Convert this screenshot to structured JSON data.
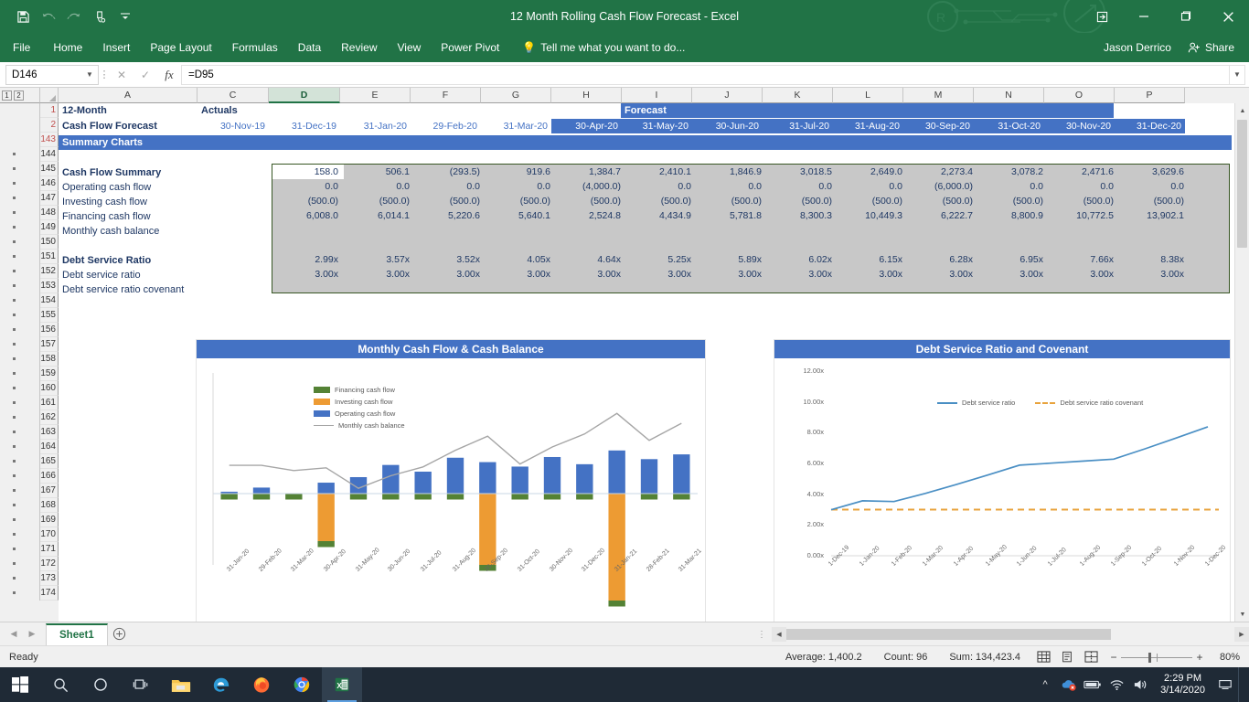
{
  "window": {
    "title": "12 Month Rolling Cash Flow Forecast - Excel",
    "user": "Jason Derrico",
    "share_label": "Share",
    "restore_icon": "restore-up-icon",
    "minimize_icon": "minimize-icon",
    "maximize_icon": "maximize-icon",
    "close_icon": "close-icon"
  },
  "qat": {
    "save": "save-icon",
    "undo": "undo-icon",
    "redo": "redo-icon",
    "touch": "touch-mode-icon",
    "more": "customize-qat-icon"
  },
  "ribbon": {
    "tabs": [
      "File",
      "Home",
      "Insert",
      "Page Layout",
      "Formulas",
      "Data",
      "Review",
      "View",
      "Power Pivot"
    ],
    "tellme": "Tell me what you want to do..."
  },
  "formula_bar": {
    "namebox": "D146",
    "formula": "=D95",
    "cancel_icon": "cancel-icon",
    "enter_icon": "enter-icon",
    "fx_icon": "insert-function-icon"
  },
  "grid": {
    "outline_levels": [
      "1",
      "2"
    ],
    "columns": [
      "A",
      "C",
      "D",
      "E",
      "F",
      "G",
      "H",
      "I",
      "J",
      "K",
      "L",
      "M",
      "N",
      "O",
      "P"
    ],
    "active_column": "D",
    "rows": [
      "1",
      "2",
      "143",
      "144",
      "145",
      "146",
      "147",
      "148",
      "149",
      "150",
      "151",
      "152",
      "153",
      "154",
      "155",
      "156",
      "157",
      "158",
      "159",
      "160",
      "161",
      "162",
      "163",
      "164",
      "165",
      "166",
      "167",
      "168",
      "169",
      "170",
      "171",
      "172",
      "173",
      "174"
    ],
    "title_row1_a": "12-Month",
    "title_row2_a": "Cash Flow Forecast",
    "actuals_label": "Actuals",
    "forecast_label": "Forecast",
    "summary_charts_label": "Summary Charts",
    "dates": [
      "30-Nov-19",
      "31-Dec-19",
      "31-Jan-20",
      "29-Feb-20",
      "31-Mar-20",
      "30-Apr-20",
      "31-May-20",
      "30-Jun-20",
      "31-Jul-20",
      "31-Aug-20",
      "30-Sep-20",
      "31-Oct-20",
      "30-Nov-20",
      "31-Dec-20"
    ],
    "row_labels": {
      "r145": "Cash Flow Summary",
      "r146": "Operating cash flow",
      "r147": "Investing cash flow",
      "r148": "Financing cash flow",
      "r149": "Monthly cash balance",
      "r151": "Debt Service Ratio",
      "r152": "Debt service ratio",
      "r153": "Debt service ratio covenant"
    },
    "table": {
      "operating_cash_flow": [
        "158.0",
        "506.1",
        "(293.5)",
        "919.6",
        "1,384.7",
        "2,410.1",
        "1,846.9",
        "3,018.5",
        "2,649.0",
        "2,273.4",
        "3,078.2",
        "2,471.6",
        "3,629.6"
      ],
      "investing_cash_flow": [
        "0.0",
        "0.0",
        "0.0",
        "0.0",
        "(4,000.0)",
        "0.0",
        "0.0",
        "0.0",
        "0.0",
        "(6,000.0)",
        "0.0",
        "0.0",
        "0.0"
      ],
      "financing_cash_flow": [
        "(500.0)",
        "(500.0)",
        "(500.0)",
        "(500.0)",
        "(500.0)",
        "(500.0)",
        "(500.0)",
        "(500.0)",
        "(500.0)",
        "(500.0)",
        "(500.0)",
        "(500.0)",
        "(500.0)"
      ],
      "monthly_cash_balance": [
        "6,008.0",
        "6,014.1",
        "5,220.6",
        "5,640.1",
        "2,524.8",
        "4,434.9",
        "5,781.8",
        "8,300.3",
        "10,449.3",
        "6,222.7",
        "8,800.9",
        "10,772.5",
        "13,902.1"
      ],
      "debt_service_ratio": [
        "2.99x",
        "3.57x",
        "3.52x",
        "4.05x",
        "4.64x",
        "5.25x",
        "5.89x",
        "6.02x",
        "6.15x",
        "6.28x",
        "6.95x",
        "7.66x",
        "8.38x"
      ],
      "debt_service_ratio_covenant": [
        "3.00x",
        "3.00x",
        "3.00x",
        "3.00x",
        "3.00x",
        "3.00x",
        "3.00x",
        "3.00x",
        "3.00x",
        "3.00x",
        "3.00x",
        "3.00x",
        "3.00x"
      ]
    }
  },
  "chart_data": [
    {
      "type": "bar",
      "title": "Monthly Cash Flow & Cash Balance",
      "xlabel": "",
      "ylabel": "",
      "grid": false,
      "legend_position": "inside-top-left",
      "categories": [
        "31-Jan-20",
        "29-Feb-20",
        "31-Mar-20",
        "30-Apr-20",
        "31-May-20",
        "30-Jun-20",
        "31-Jul-20",
        "31-Aug-20",
        "30-Sep-20",
        "31-Oct-20",
        "30-Nov-20",
        "31-Dec-20",
        "31-Jan-21",
        "28-Feb-21",
        "31-Mar-21"
      ],
      "series": [
        {
          "name": "Financing cash flow",
          "color": "#548235",
          "values": [
            -500,
            -500,
            -500,
            -500,
            -500,
            -500,
            -500,
            -500,
            -500,
            -500,
            -500,
            -500,
            -500,
            -500,
            -500
          ]
        },
        {
          "name": "Investing cash flow",
          "color": "#ed9b33",
          "values": [
            0,
            0,
            0,
            -4000,
            0,
            0,
            0,
            0,
            -6000,
            0,
            0,
            0,
            -9000,
            0,
            0
          ]
        },
        {
          "name": "Operating cash flow",
          "color": "#4472c4",
          "values": [
            158,
            506,
            -294,
            920,
            1385,
            2410,
            1847,
            3019,
            2649,
            2273,
            3078,
            2472,
            3630,
            2900,
            3300
          ]
        },
        {
          "name": "Monthly cash balance",
          "color": "#a6a6a6",
          "type": "line",
          "values": [
            6008,
            6014,
            5221,
            5640,
            2525,
            4435,
            5782,
            8300,
            10449,
            6223,
            8801,
            10773,
            13902,
            9800,
            12400
          ]
        }
      ]
    },
    {
      "type": "line",
      "title": "Debt Service Ratio and Covenant",
      "xlabel": "",
      "ylabel": "",
      "grid": false,
      "legend_position": "top-center",
      "ylim": [
        0,
        12
      ],
      "yticks": [
        "0.00x",
        "2.00x",
        "4.00x",
        "6.00x",
        "8.00x",
        "10.00x",
        "12.00x"
      ],
      "categories": [
        "1-Dec-19",
        "1-Jan-20",
        "1-Feb-20",
        "1-Mar-20",
        "1-Apr-20",
        "1-May-20",
        "1-Jun-20",
        "1-Jul-20",
        "1-Aug-20",
        "1-Sep-20",
        "1-Oct-20",
        "1-Nov-20",
        "1-Dec-20"
      ],
      "series": [
        {
          "name": "Debt service ratio",
          "color": "#4a8fc4",
          "values": [
            2.99,
            3.57,
            3.52,
            4.05,
            4.64,
            5.25,
            5.89,
            6.02,
            6.15,
            6.28,
            6.95,
            7.66,
            8.38
          ]
        },
        {
          "name": "Debt service ratio covenant",
          "color": "#e8a33d",
          "dash": true,
          "values": [
            3.0,
            3.0,
            3.0,
            3.0,
            3.0,
            3.0,
            3.0,
            3.0,
            3.0,
            3.0,
            3.0,
            3.0,
            3.0
          ]
        }
      ]
    }
  ],
  "sheet_tabs": {
    "tabs": [
      "Sheet1"
    ],
    "active": "Sheet1",
    "add_label": "+"
  },
  "status_bar": {
    "ready": "Ready",
    "average": "Average: 1,400.2",
    "count": "Count: 96",
    "sum": "Sum: 134,423.4",
    "view_normal": "normal-view-icon",
    "view_page_layout": "page-layout-view-icon",
    "view_page_break": "page-break-view-icon",
    "zoom_out": "−",
    "zoom_in": "+",
    "zoom_level": "80%"
  },
  "taskbar": {
    "start": "windows-start-icon",
    "search": "search-icon",
    "cortana": "cortana-icon",
    "taskview": "task-view-icon",
    "explorer": "file-explorer-icon",
    "edge": "edge-icon",
    "firefox": "firefox-icon",
    "chrome": "chrome-icon",
    "excel": "excel-icon",
    "time": "2:29 PM",
    "date": "3/14/2020",
    "tray_up": "show-hidden-icons",
    "battery": "battery-icon",
    "wifi": "wifi-icon",
    "volume": "volume-icon"
  }
}
